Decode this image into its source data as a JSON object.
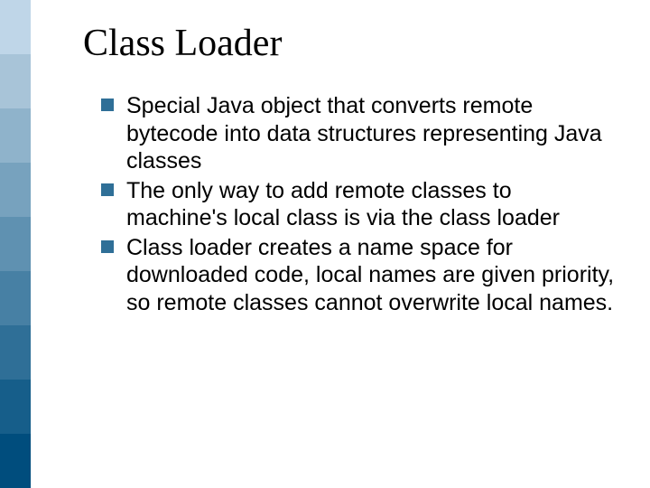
{
  "title": "Class Loader",
  "bullets": [
    "Special Java object that converts remote bytecode into data structures representing Java classes",
    "The only way to add remote classes to machine's local class is via the class loader",
    "Class loader creates a name space for downloaded code, local names are given priority, so remote classes cannot overwrite local names."
  ]
}
